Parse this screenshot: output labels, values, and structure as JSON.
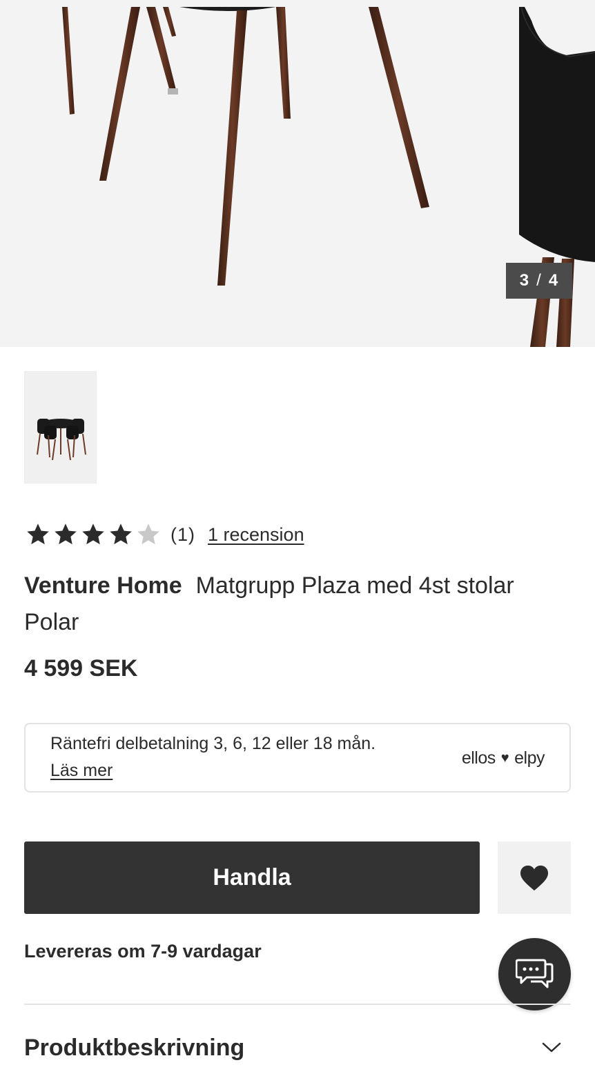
{
  "gallery": {
    "counter_current": "3",
    "counter_separator": "/",
    "counter_total": "4"
  },
  "rating": {
    "value": 4,
    "max": 5,
    "count_text": "(1)",
    "review_link": "1 recension"
  },
  "product": {
    "brand": "Venture Home",
    "name": "Matgrupp Plaza med 4st stolar Polar",
    "price": "4 599 SEK"
  },
  "finance": {
    "text": "Räntefri delbetalning 3, 6, 12 eller 18 mån.",
    "link": "Läs mer",
    "logo_left": "ellos",
    "logo_right": "elpy"
  },
  "actions": {
    "buy_label": "Handla"
  },
  "delivery": {
    "text": "Levereras om 7-9 vardagar"
  },
  "sections": {
    "description_title": "Produktbeskrivning"
  },
  "icons": {
    "favorite": "heart-icon",
    "chat": "chat-icon",
    "expand": "chevron-down-icon",
    "star": "star-icon"
  },
  "colors": {
    "primary_button": "#333333",
    "star_filled": "#2b2b2b",
    "star_empty": "#c8c8c8"
  }
}
